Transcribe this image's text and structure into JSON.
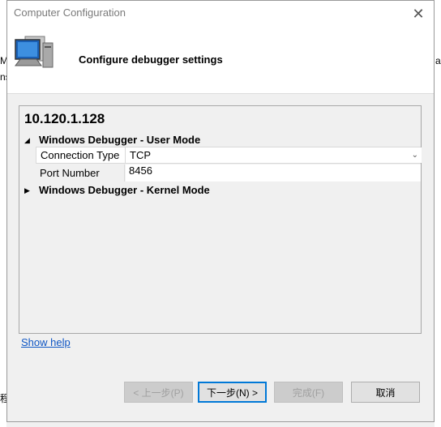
{
  "background": {
    "left_fragment_1": "M",
    "left_fragment_2": "ns",
    "left_fragment_3": "程",
    "right_fragment": "a"
  },
  "window": {
    "title": "Computer Configuration",
    "close_glyph": "✕"
  },
  "header": {
    "title": "Configure debugger settings"
  },
  "panel": {
    "host": "10.120.1.128",
    "categories": [
      {
        "label": "Windows Debugger - User Mode",
        "expanded": true,
        "toggle_glyph": "◢"
      },
      {
        "label": "Windows Debugger - Kernel Mode",
        "expanded": false,
        "toggle_glyph": "▶"
      }
    ],
    "properties": [
      {
        "name": "Connection Type",
        "value": "TCP",
        "dropdown_glyph": "⌄"
      },
      {
        "name": "Port Number",
        "value": "8456"
      }
    ]
  },
  "help_link": "Show help",
  "buttons": {
    "back": "< 上一步(P)",
    "next": "下一步(N) >",
    "finish": "完成(F)",
    "cancel": "取消"
  }
}
